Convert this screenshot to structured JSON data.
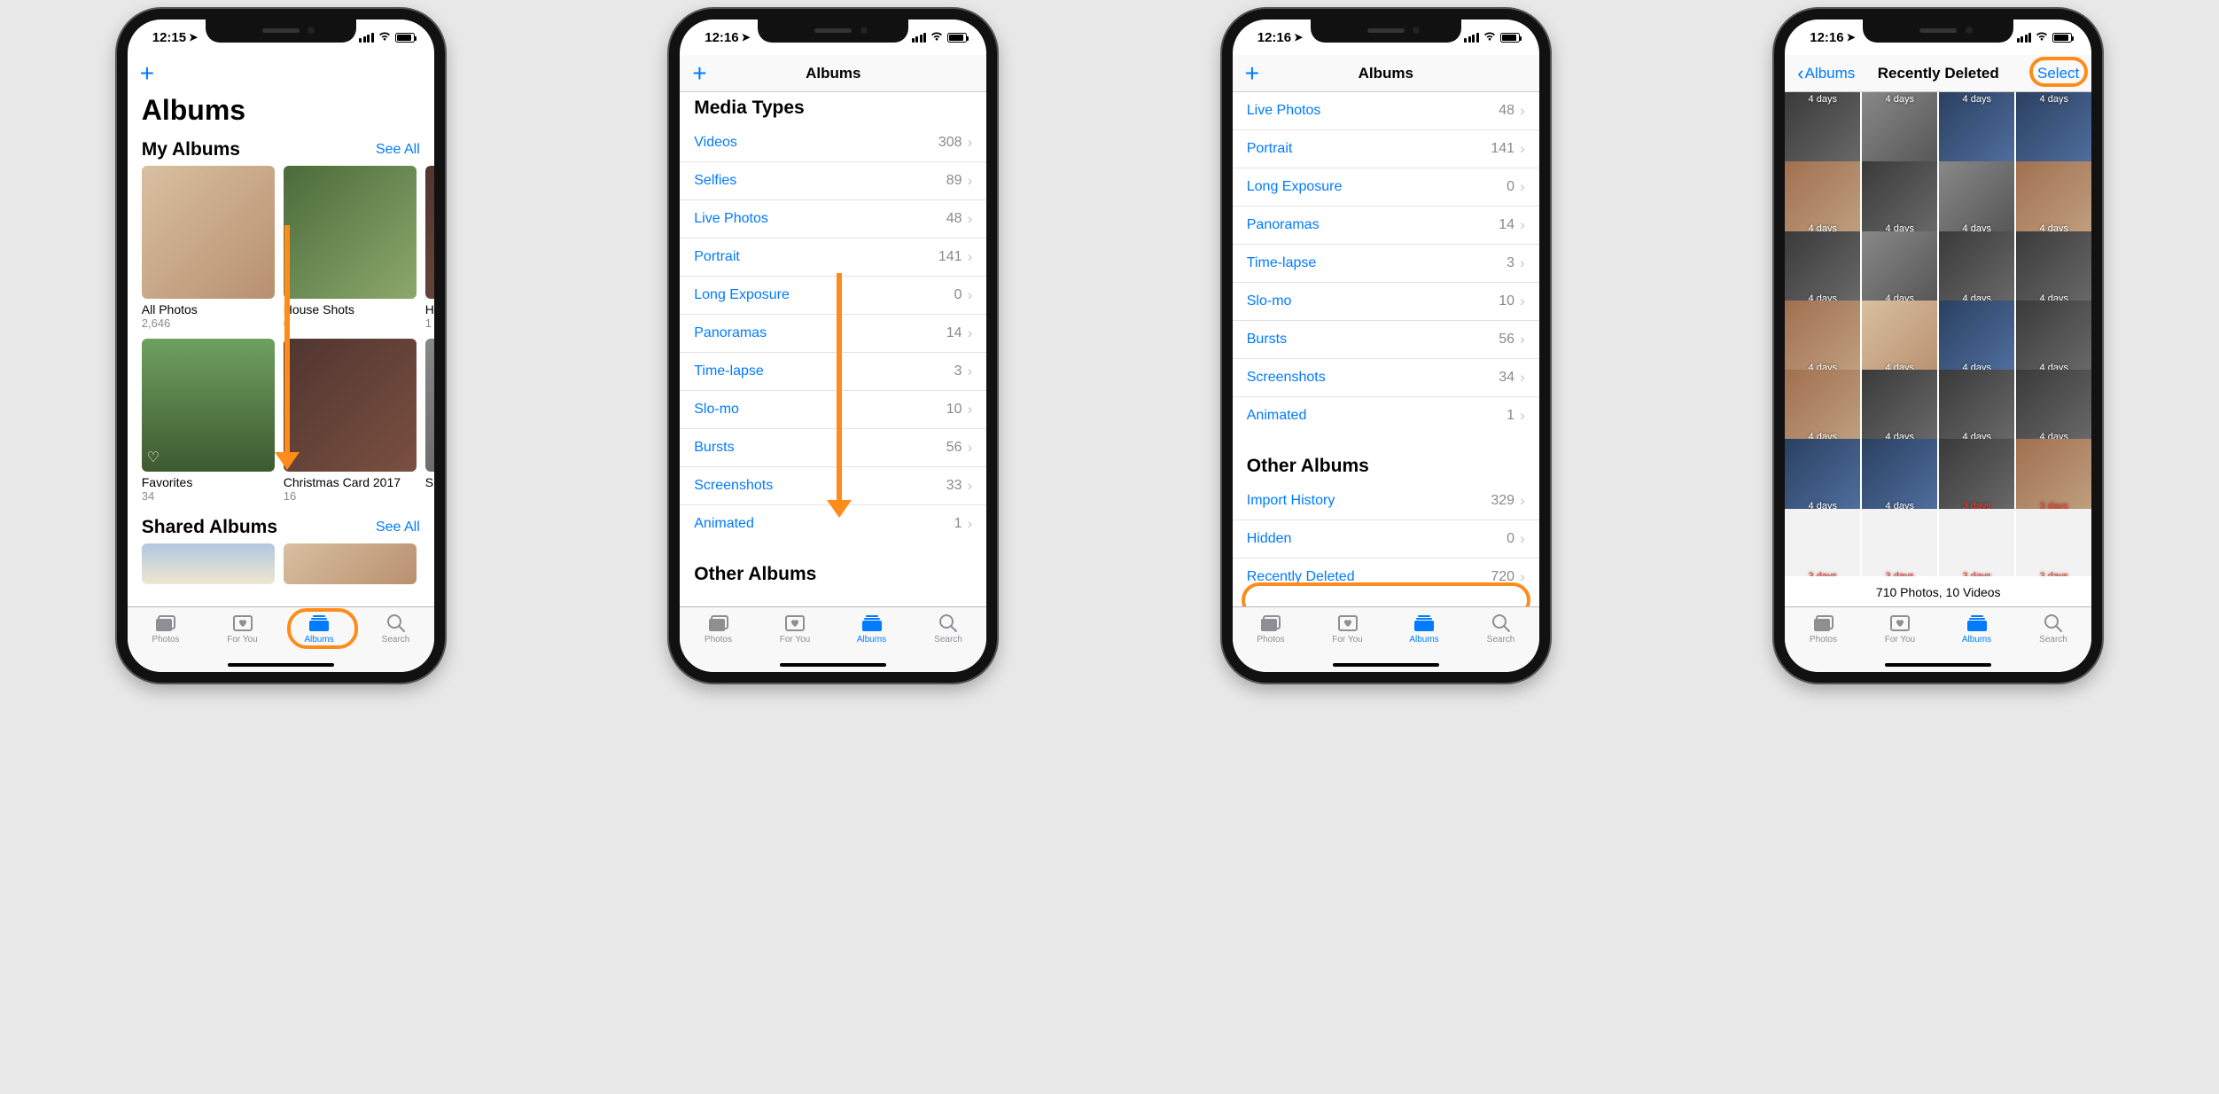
{
  "status": {
    "time1": "12:15",
    "time2": "12:16"
  },
  "nav": {
    "plus": "+",
    "albums_title": "Albums",
    "back_link": "Albums",
    "rd_title": "Recently Deleted",
    "select": "Select"
  },
  "screen1": {
    "large_title": "Albums",
    "my_albums_header": "My Albums",
    "see_all": "See All",
    "shared_albums_header": "Shared Albums",
    "albums": [
      {
        "name": "All Photos",
        "count": "2,646"
      },
      {
        "name": "House Shots",
        "count": "6"
      },
      {
        "name": "H",
        "count": "1"
      },
      {
        "name": "Favorites",
        "count": "34"
      },
      {
        "name": "Christmas Card 2017",
        "count": "16"
      },
      {
        "name": "S",
        "count": ""
      }
    ]
  },
  "screen2": {
    "media_types_header": "Media Types",
    "other_albums_header": "Other Albums",
    "items": [
      {
        "label": "Videos",
        "value": "308"
      },
      {
        "label": "Selfies",
        "value": "89"
      },
      {
        "label": "Live Photos",
        "value": "48"
      },
      {
        "label": "Portrait",
        "value": "141"
      },
      {
        "label": "Long Exposure",
        "value": "0"
      },
      {
        "label": "Panoramas",
        "value": "14"
      },
      {
        "label": "Time-lapse",
        "value": "3"
      },
      {
        "label": "Slo-mo",
        "value": "10"
      },
      {
        "label": "Bursts",
        "value": "56"
      },
      {
        "label": "Screenshots",
        "value": "33"
      },
      {
        "label": "Animated",
        "value": "1"
      }
    ]
  },
  "screen3": {
    "other_albums_header": "Other Albums",
    "items": [
      {
        "label": "Live Photos",
        "value": "48"
      },
      {
        "label": "Portrait",
        "value": "141"
      },
      {
        "label": "Long Exposure",
        "value": "0"
      },
      {
        "label": "Panoramas",
        "value": "14"
      },
      {
        "label": "Time-lapse",
        "value": "3"
      },
      {
        "label": "Slo-mo",
        "value": "10"
      },
      {
        "label": "Bursts",
        "value": "56"
      },
      {
        "label": "Screenshots",
        "value": "34"
      },
      {
        "label": "Animated",
        "value": "1"
      }
    ],
    "other_items": [
      {
        "label": "Import History",
        "value": "329"
      },
      {
        "label": "Hidden",
        "value": "0"
      },
      {
        "label": "Recently Deleted",
        "value": "720"
      }
    ]
  },
  "screen4": {
    "summary": "710 Photos, 10 Videos",
    "cells": [
      {
        "label": "4 days",
        "tex": "tex-g",
        "top": true
      },
      {
        "label": "4 days",
        "tex": "tex-f",
        "top": true
      },
      {
        "label": "4 days",
        "tex": "tex-h",
        "top": true
      },
      {
        "label": "4 days",
        "tex": "tex-h",
        "top": true
      },
      {
        "label": "4 days",
        "tex": "tex-j"
      },
      {
        "label": "4 days",
        "tex": "tex-g"
      },
      {
        "label": "4 days",
        "tex": "tex-f"
      },
      {
        "label": "4 days",
        "tex": "tex-j"
      },
      {
        "label": "4 days",
        "tex": "tex-g"
      },
      {
        "label": "4 days",
        "tex": "tex-f"
      },
      {
        "label": "4 days",
        "tex": "tex-g"
      },
      {
        "label": "4 days",
        "tex": "tex-g"
      },
      {
        "label": "4 days",
        "tex": "tex-j"
      },
      {
        "label": "4 days",
        "tex": "tex-a"
      },
      {
        "label": "4 days",
        "tex": "tex-h"
      },
      {
        "label": "4 days",
        "tex": "tex-g"
      },
      {
        "label": "4 days",
        "tex": "tex-j"
      },
      {
        "label": "4 days",
        "tex": "tex-g"
      },
      {
        "label": "4 days",
        "tex": "tex-g"
      },
      {
        "label": "4 days",
        "tex": "tex-g"
      },
      {
        "label": "4 days",
        "tex": "tex-h"
      },
      {
        "label": "4 days",
        "tex": "tex-h"
      },
      {
        "label": "3 days",
        "tex": "tex-g",
        "red": true
      },
      {
        "label": "3 days",
        "tex": "tex-j",
        "red": true
      },
      {
        "label": "3 days",
        "tex": "tex-white",
        "red": true
      },
      {
        "label": "3 days",
        "tex": "tex-white",
        "red": true
      },
      {
        "label": "3 days",
        "tex": "tex-white",
        "red": true
      },
      {
        "label": "3 days",
        "tex": "tex-white",
        "red": true
      }
    ]
  },
  "tabs": {
    "photos": "Photos",
    "for_you": "For You",
    "albums": "Albums",
    "search": "Search"
  }
}
